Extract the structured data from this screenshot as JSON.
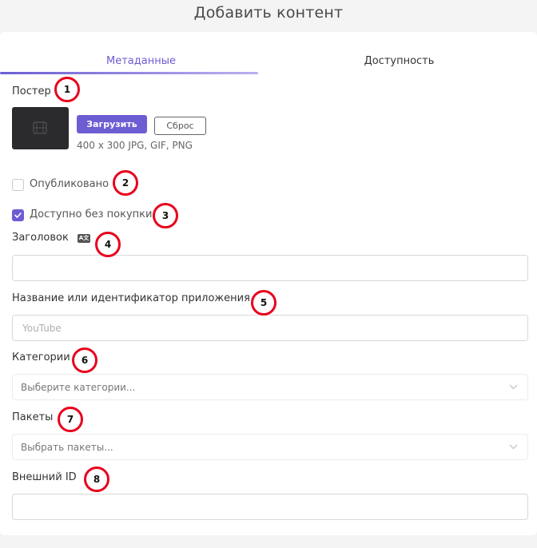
{
  "dialog": {
    "title": "Добавить контент"
  },
  "tabs": [
    {
      "label": "Метаданные",
      "active": true
    },
    {
      "label": "Доступность",
      "active": false
    }
  ],
  "poster": {
    "label": "Постер",
    "upload_label": "Загрузить",
    "reset_label": "Сброс",
    "hint": "400 x 300 JPG, GIF, PNG"
  },
  "published": {
    "label": "Опубликовано",
    "checked": false
  },
  "free_access": {
    "label": "Доступно без покупки",
    "checked": true
  },
  "title_field": {
    "label": "Заголовок",
    "value": "",
    "lang_icon": "A文"
  },
  "app_field": {
    "label": "Название или идентификатор приложения",
    "placeholder": "YouTube"
  },
  "categories": {
    "label": "Категории",
    "placeholder": "Выберите категории..."
  },
  "packages": {
    "label": "Пакеты",
    "placeholder": "Выбрать пакеты..."
  },
  "external_id": {
    "label": "Внешний ID",
    "value": ""
  },
  "markers": [
    "1",
    "2",
    "3",
    "4",
    "5",
    "6",
    "7",
    "8"
  ],
  "colors": {
    "accent": "#6c5dd3",
    "marker": "#e8001c"
  },
  "icons": {
    "poster": "film-icon",
    "chevron": "chevron-down-icon",
    "check": "checkmark-icon"
  }
}
